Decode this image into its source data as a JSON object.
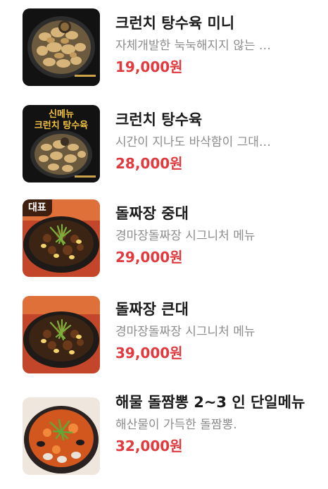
{
  "menu": {
    "items": [
      {
        "name": "크런치 탕수육 미니",
        "description": "자체개발한 눅눅해지지 않는 …",
        "price": "19,000원",
        "image": "crunchy-sweet-sour-pork-photo",
        "badge": "",
        "image_text": []
      },
      {
        "name": "크런치 탕수육",
        "description": "시간이 지나도 바삭함이 그대…",
        "price": "28,000원",
        "image": "crunchy-sweet-sour-pork-photo",
        "badge": "",
        "image_text": [
          "신메뉴",
          "크런치 탕수육"
        ]
      },
      {
        "name": "돌짜장 중대",
        "description": "경마장돌짜장 시그니처 메뉴",
        "price": "29,000원",
        "image": "stone-pot-jjajang-photo",
        "badge": "대표",
        "image_text": []
      },
      {
        "name": "돌짜장 큰대",
        "description": "경마장돌짜장 시그니처 메뉴",
        "price": "39,000원",
        "image": "stone-pot-jjajang-photo",
        "badge": "",
        "image_text": []
      },
      {
        "name": "해물 돌짬뽕 2~3 인 단일메뉴",
        "description": "해산물이 가득한 돌짬뽕.",
        "price": "32,000원",
        "image": "seafood-jjamppong-photo",
        "badge": "",
        "image_text": []
      }
    ]
  },
  "colors": {
    "price": "#e0393e",
    "name": "#1a1a1a",
    "description": "#8c8c8c"
  }
}
